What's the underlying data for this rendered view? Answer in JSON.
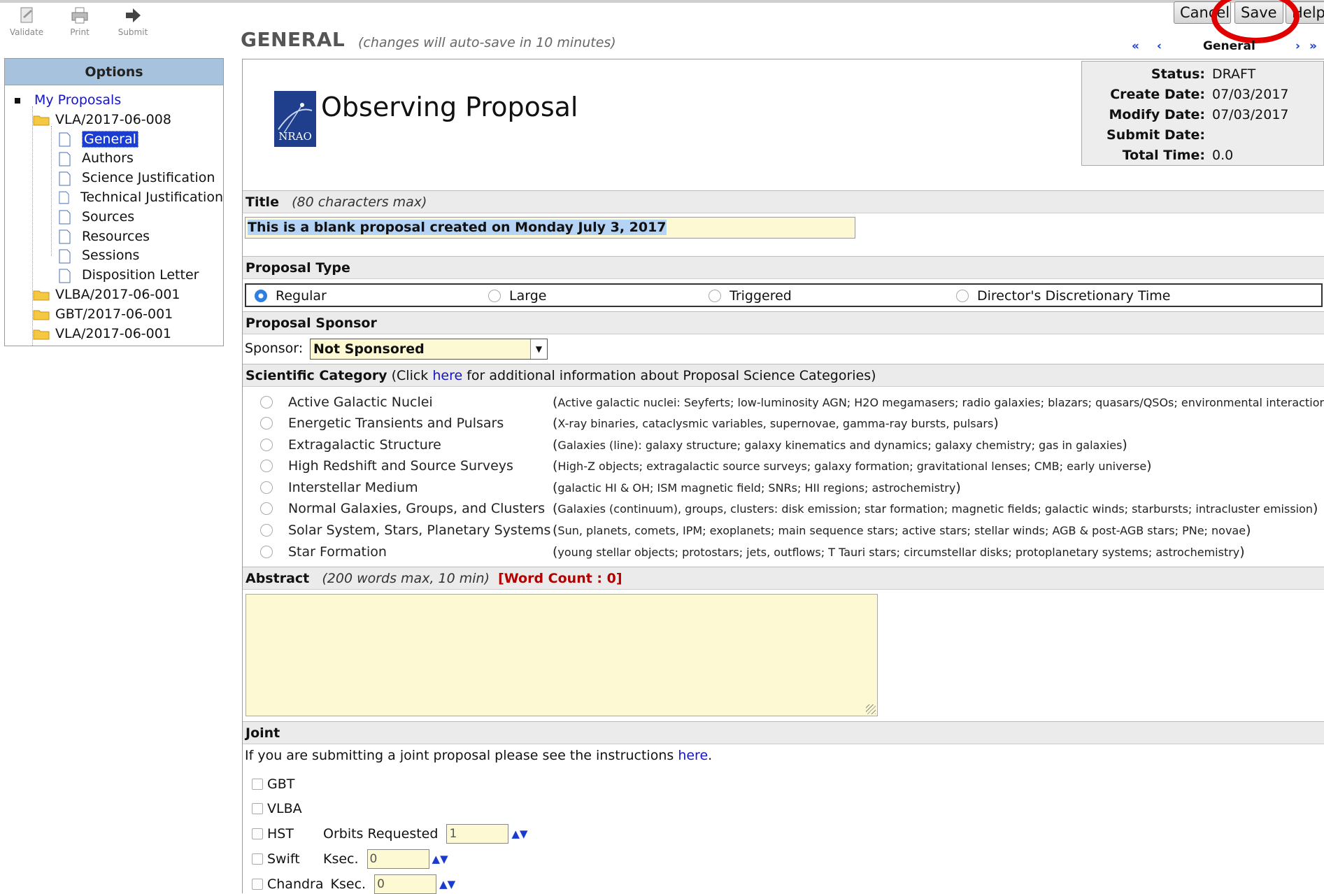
{
  "toolbar": {
    "validate_label": "Validate",
    "print_label": "Print",
    "submit_label": "Submit"
  },
  "header": {
    "section_title": "GENERAL",
    "autosave_note": "(changes will auto-save in 10 minutes)",
    "nav_current": "General",
    "first_icon": "«",
    "prev_icon": "‹",
    "next_icon": "›",
    "last_icon": "»"
  },
  "actions": {
    "cancel_label": "Cancel",
    "save_label": "Save",
    "help_label": "Help"
  },
  "options": {
    "title": "Options",
    "root_label": "My Proposals",
    "proposal_active": "VLA/2017-06-008",
    "pages": [
      "General",
      "Authors",
      "Science Justification",
      "Technical Justification",
      "Sources",
      "Resources",
      "Sessions",
      "Disposition Letter"
    ],
    "other_proposals": [
      "VLBA/2017-06-001",
      "GBT/2017-06-001",
      "VLA/2017-06-001"
    ]
  },
  "doc": {
    "logo_text": "NRAO",
    "title": "Observing Proposal"
  },
  "status": {
    "status_label": "Status:",
    "status_value": "DRAFT",
    "create_label": "Create Date:",
    "create_value": "07/03/2017",
    "modify_label": "Modify Date:",
    "modify_value": "07/03/2017",
    "submit_label": "Submit Date:",
    "submit_value": "",
    "total_label": "Total Time:",
    "total_value": "0.0"
  },
  "title_field": {
    "label": "Title",
    "hint": "(80 characters max)",
    "value": "This is a blank proposal created on Monday July 3, 2017"
  },
  "proposal_type": {
    "label": "Proposal Type",
    "options": [
      "Regular",
      "Large",
      "Triggered",
      "Director's Discretionary Time"
    ],
    "selected": "Regular"
  },
  "sponsor": {
    "section_label": "Proposal Sponsor",
    "field_label": "Sponsor:",
    "value": "Not Sponsored"
  },
  "science": {
    "label": "Scientific Category",
    "note_pre": "(Click",
    "note_link": "here",
    "note_post": "for additional information about Proposal Science Categories)",
    "categories": [
      {
        "name": "Active Galactic Nuclei",
        "desc": "Active galactic nuclei: Seyferts; low-luminosity AGN; H2O megamasers; radio galaxies; blazars; quasars/QSOs; environmental interactions"
      },
      {
        "name": "Energetic Transients and Pulsars",
        "desc": "X-ray binaries, cataclysmic variables, supernovae, gamma-ray bursts, pulsars"
      },
      {
        "name": "Extragalactic Structure",
        "desc": "Galaxies (line): galaxy structure; galaxy kinematics and dynamics; galaxy chemistry; gas in galaxies"
      },
      {
        "name": "High Redshift and Source Surveys",
        "desc": "High-Z objects; extragalactic source surveys; galaxy formation; gravitational lenses; CMB; early universe"
      },
      {
        "name": "Interstellar Medium",
        "desc": "galactic HI & OH; ISM magnetic field; SNRs; HII regions; astrochemistry"
      },
      {
        "name": "Normal Galaxies, Groups, and Clusters",
        "desc": "Galaxies (continuum), groups, clusters: disk emission; star formation; magnetic fields; galactic winds; starbursts; intracluster emission"
      },
      {
        "name": "Solar System, Stars, Planetary Systems",
        "desc": "Sun, planets, comets, IPM; exoplanets; main sequence stars; active stars; stellar winds; AGB & post-AGB stars; PNe; novae"
      },
      {
        "name": "Star Formation",
        "desc": "young stellar objects; protostars; jets, outflows; T Tauri stars; circumstellar disks; protoplanetary systems; astrochemistry"
      }
    ]
  },
  "abstract": {
    "label": "Abstract",
    "hint": "(200 words max, 10 min)",
    "word_count": "[Word Count : 0]",
    "value": ""
  },
  "joint": {
    "label": "Joint",
    "text_pre": "If you are submitting a joint proposal please see the instructions",
    "text_link": "here",
    "text_post": ".",
    "gbt": "GBT",
    "vlba": "VLBA",
    "hst": "HST",
    "hst_field_label": "Orbits Requested",
    "hst_value": "1",
    "swift": "Swift",
    "swift_field_label": "Ksec.",
    "swift_value": "0",
    "chandra": "Chandra",
    "chandra_field_label": "Ksec.",
    "chandra_value": "0"
  },
  "colors": {
    "accent_blue": "#1c3dd1",
    "field_yellow": "#fdfad3",
    "panel_header": "#a7c2dd",
    "annotation_red": "#e00000",
    "word_count_red": "#b30000"
  },
  "icons": {
    "validate": "validate-icon",
    "print": "print-icon",
    "submit": "arrow-right-icon",
    "folder": "folder-icon",
    "page": "document-icon"
  }
}
